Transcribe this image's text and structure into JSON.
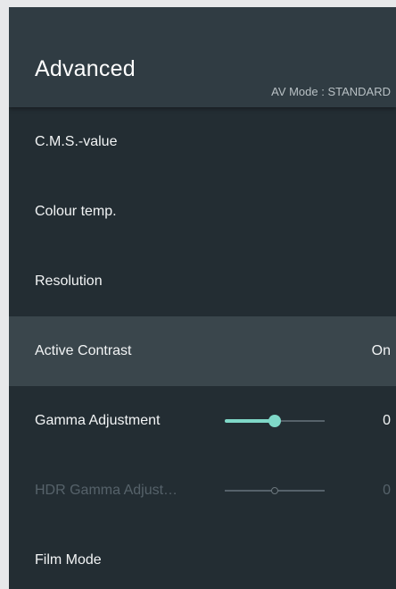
{
  "header": {
    "title": "Advanced",
    "av_mode": "AV Mode : STANDARD"
  },
  "items": [
    {
      "label": "C.M.S.-value"
    },
    {
      "label": "Colour temp."
    },
    {
      "label": "Resolution"
    },
    {
      "label": "Active Contrast",
      "value": "On",
      "selected": true
    },
    {
      "label": "Gamma Adjustment",
      "value": "0",
      "slider_level": 0.5
    },
    {
      "label": "HDR Gamma Adjust…",
      "value": "0",
      "slider_level": 0.5,
      "disabled": true
    },
    {
      "label": "Film Mode"
    }
  ],
  "colors": {
    "panel": "#232d33",
    "header": "#303c43",
    "selected_row": "#3a464c",
    "accent": "#7fd8c8",
    "disabled_text": "#56626a"
  }
}
